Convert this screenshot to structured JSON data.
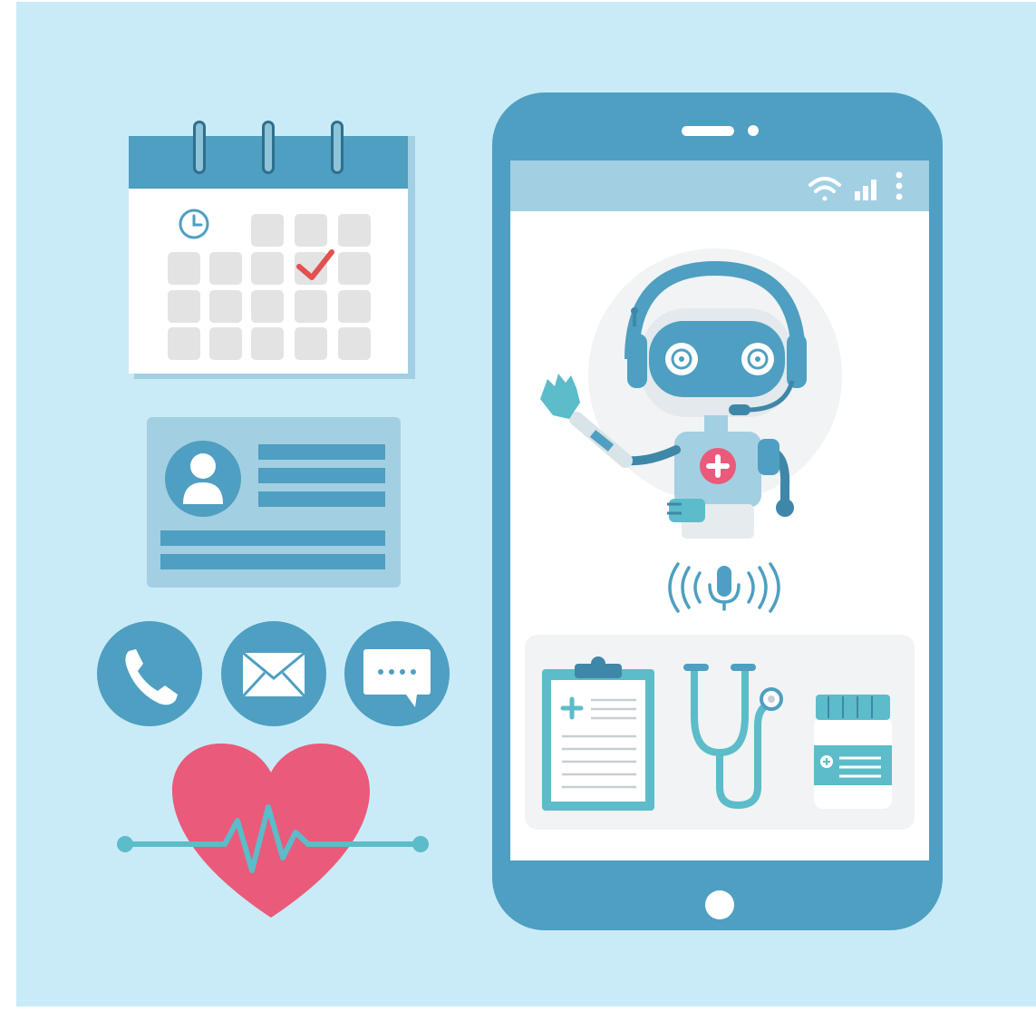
{
  "colors": {
    "background": "#c9ebf7",
    "frame": "#ffffff",
    "primary_blue": "#4e9fc1",
    "light_blue": "#a3cfe2",
    "dark_blue": "#3f87a8",
    "screen_white": "#ffffff",
    "gray_cell": "#e3e3e3",
    "check_red": "#e25050",
    "heart_pink": "#ea5a7a",
    "teal": "#5cbcc9",
    "robot_gray": "#eef2f4"
  },
  "icons": {
    "calendar": "calendar-icon",
    "clock": "clock-icon",
    "checkmark": "checkmark-icon",
    "profile_card": "id-card-icon",
    "avatar": "user-avatar-icon",
    "phone": "phone-icon",
    "mail": "envelope-icon",
    "chat": "chat-bubble-icon",
    "heart": "heart-rate-icon",
    "smartphone": "smartphone-icon",
    "wifi": "wifi-icon",
    "signal": "signal-bars-icon",
    "menu": "kebab-menu-icon",
    "robot": "medical-robot-icon",
    "microphone": "microphone-icon",
    "clipboard": "medical-clipboard-icon",
    "stethoscope": "stethoscope-icon",
    "pill_bottle": "medicine-bottle-icon"
  },
  "calendar": {
    "checked_day": "row-2-col-4"
  }
}
